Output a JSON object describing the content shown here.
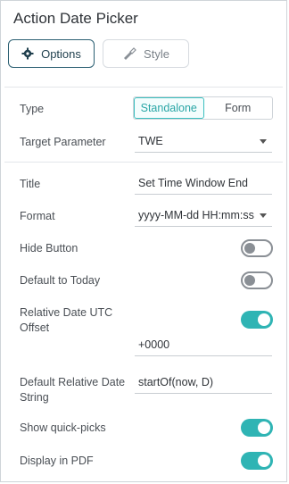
{
  "panel": {
    "title": "Action Date Picker",
    "tabs": {
      "options": "Options",
      "style": "Style"
    }
  },
  "type": {
    "label": "Type",
    "options": [
      "Standalone",
      "Form"
    ],
    "selected": "Standalone"
  },
  "target_parameter": {
    "label": "Target Parameter",
    "value": "TWE"
  },
  "title_field": {
    "label": "Title",
    "value": "Set Time Window End"
  },
  "format": {
    "label": "Format",
    "value": "yyyy-MM-dd HH:mm:ss"
  },
  "hide_button": {
    "label": "Hide Button",
    "on": false
  },
  "default_to_today": {
    "label": "Default to Today",
    "on": false
  },
  "relative_offset": {
    "label_line1": "Relative Date UTC",
    "label_line2": "Offset",
    "on": true,
    "value": "+0000"
  },
  "default_relative": {
    "label_line1": "Default Relative Date",
    "label_line2": "String",
    "value": "startOf(now, D)"
  },
  "show_quick_picks": {
    "label": "Show quick-picks",
    "on": true
  },
  "display_in_pdf": {
    "label": "Display in PDF",
    "on": true
  },
  "colors": {
    "accent": "#2fb4b4",
    "primary_border": "#2b5f72"
  }
}
